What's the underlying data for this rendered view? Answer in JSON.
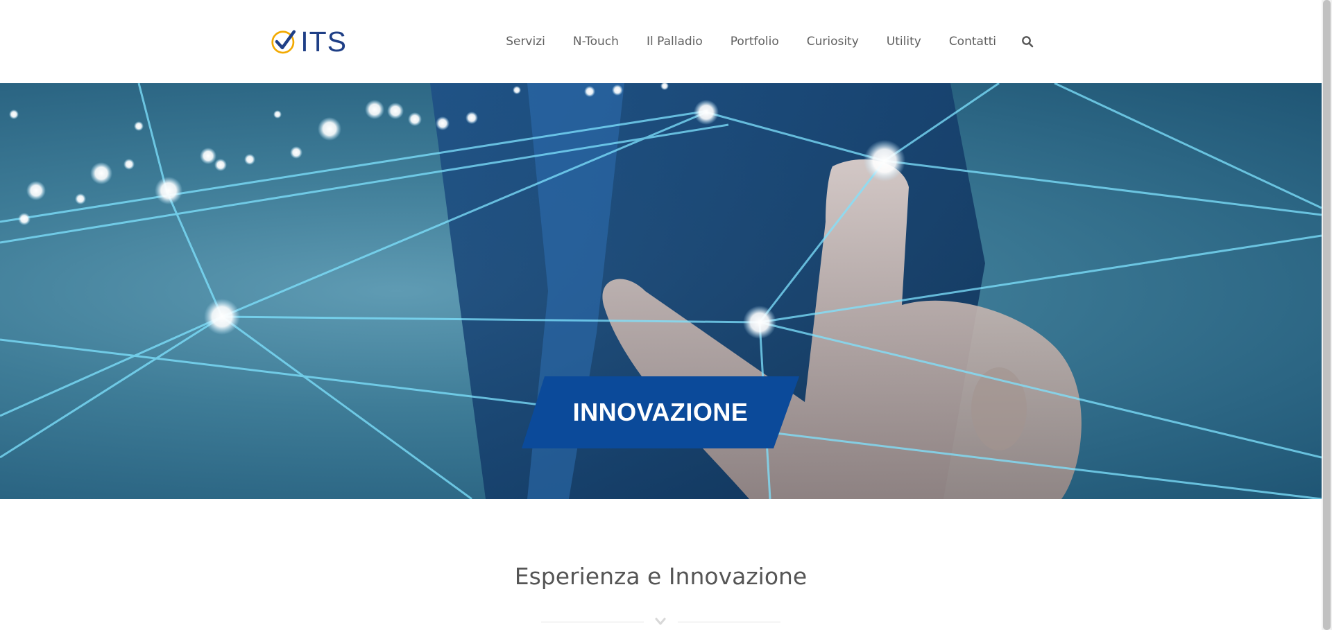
{
  "logo": {
    "text_main": "ITS",
    "icon": "check-circle-icon"
  },
  "nav": {
    "items": [
      {
        "label": "Servizi"
      },
      {
        "label": "N-Touch"
      },
      {
        "label": "Il Palladio"
      },
      {
        "label": "Portfolio"
      },
      {
        "label": "Curiosity"
      },
      {
        "label": "Utility"
      },
      {
        "label": "Contatti"
      }
    ],
    "search_icon": "search-icon"
  },
  "hero": {
    "caption": "INNOVAZIONE",
    "caption_bg": "#0b4a9a"
  },
  "section": {
    "title": "Esperienza e Innovazione",
    "divider_icon": "chevron-down-icon"
  },
  "colors": {
    "brand_blue": "#1f3f86",
    "brand_gold": "#f2a900",
    "nav_text": "#5f5f5f"
  }
}
